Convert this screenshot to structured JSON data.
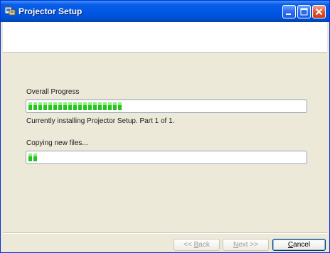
{
  "window": {
    "title": "Projector Setup"
  },
  "overall": {
    "label": "Overall Progress",
    "progress": 0.34,
    "status": "Currently installing Projector Setup.  Part 1 of 1."
  },
  "files": {
    "label": "Copying new files...",
    "progress": 0.03
  },
  "buttons": {
    "back": {
      "pre": "<< ",
      "accel": "B",
      "post": "ack"
    },
    "next": {
      "pre": "",
      "accel": "N",
      "post": "ext >>"
    },
    "cancel": {
      "pre": "",
      "accel": "C",
      "post": "ancel"
    }
  }
}
